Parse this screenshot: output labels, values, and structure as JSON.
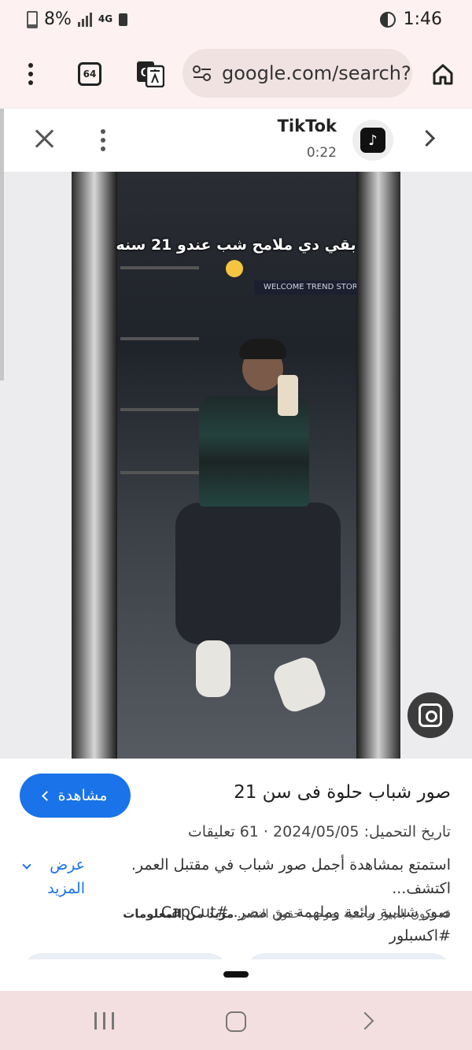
{
  "status_bar": {
    "battery_percent": "8%",
    "network_label": "4G",
    "time": "1:46"
  },
  "toolbar": {
    "tab_count": "64",
    "url": "google.com/search?"
  },
  "viewer": {
    "source_name": "TikTok",
    "duration": "0:22",
    "image_caption": "بقي دي ملامح شب عندو 21 سنه",
    "store_sign": "WELCOME  TREND STORE"
  },
  "result": {
    "watch_button_label": "مشاهدة",
    "title": "صور شباب حلوة فى سن 21",
    "meta": "تاريخ التحميل: 2024/05/05 · 61 تعليقات",
    "description_line1": "استمتع بمشاهدة أجمل صور شباب في مقتبل العمر. اكتشف...",
    "description_line2": "صور شبابية رائعة وملهمة من مصر. #CapCut #اكسبلور",
    "show_more_label": "عرض المزيد",
    "copyright_note": "قد تكون الصور محمية بموجب حقوق النشر.",
    "more_info_label": "مزيد من المعلومات"
  },
  "colors": {
    "accent": "#1a73e8",
    "chrome_bg": "#fdf1f1",
    "nav_bg": "#f4dfe0"
  },
  "icons": [
    "three-dots-vertical-icon",
    "tabs-icon",
    "translate-icon",
    "site-settings-icon",
    "home-icon",
    "close-icon",
    "tiktok-logo-icon",
    "chevron-right-icon",
    "google-lens-icon"
  ]
}
